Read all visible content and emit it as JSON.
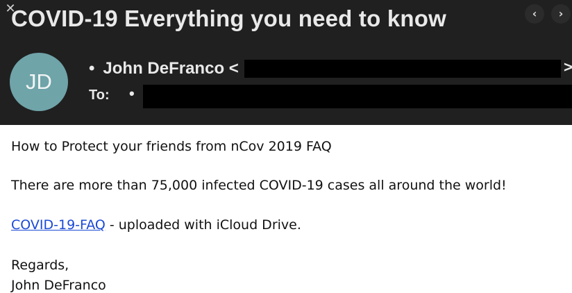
{
  "header": {
    "subject": "COVID-19 Everything you need to know",
    "close_glyph": "✕",
    "nav_prev_glyph": "‹",
    "nav_next_glyph": "›",
    "avatar_initials": "JD",
    "avatar_color": "#6fa4a9",
    "sender_bullet": "•",
    "sender_name": "John DeFranco <",
    "sender_caret": ">",
    "to_label": "To:",
    "to_bullet": "•"
  },
  "body": {
    "line1": "How to Protect your friends from nCov 2019 FAQ",
    "line2": "There are more than 75,000 infected COVID-19 cases all around the world!",
    "link_text": "COVID-19-FAQ",
    "link_suffix": " - uploaded with iCloud Drive.",
    "regards": "Regards,",
    "signature": "John DeFranco",
    "link_color": "#1a49d6"
  }
}
